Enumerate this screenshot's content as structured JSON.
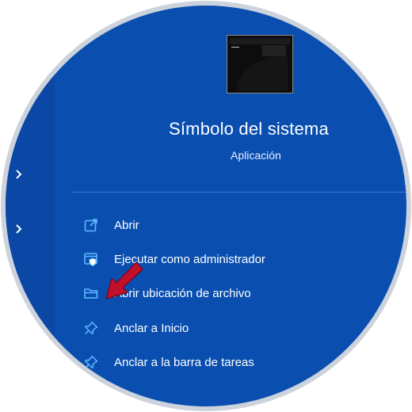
{
  "header": {
    "app_name": "Símbolo del sistema",
    "app_type": "Aplicación"
  },
  "left_pane": {
    "chevrons": [
      "chevron-right-icon",
      "chevron-right-icon"
    ]
  },
  "menu": {
    "items": [
      {
        "label": "Abrir",
        "icon": "open-external-icon"
      },
      {
        "label": "Ejecutar como administrador",
        "icon": "admin-shield-icon"
      },
      {
        "label": "Abrir ubicación de archivo",
        "icon": "folder-icon"
      },
      {
        "label": "Anclar a Inicio",
        "icon": "pin-icon"
      },
      {
        "label": "Anclar a la barra de tareas",
        "icon": "pin-icon"
      }
    ]
  },
  "colors": {
    "background": "#0a4fb0",
    "accent_icon": "#5fb8ff",
    "annotation_arrow": "#c0102a"
  }
}
